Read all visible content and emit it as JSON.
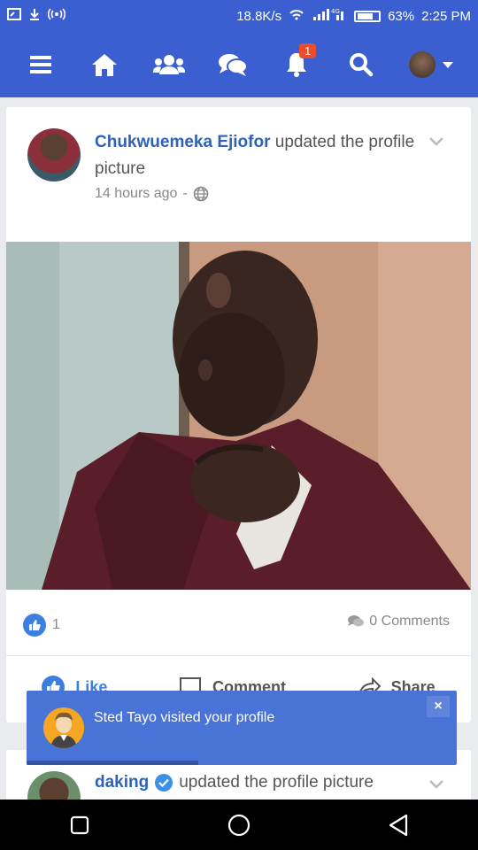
{
  "status_bar": {
    "speed": "18.8K/s",
    "network": "4G",
    "battery": "63%",
    "time": "2:25 PM"
  },
  "nav": {
    "notifications_badge": "1"
  },
  "post": {
    "author": "Chukwuemeka Ejiofor",
    "action": "updated the profile picture",
    "time": "14 hours ago",
    "separator": "-",
    "like_count": "1",
    "comments": "0 Comments",
    "actions": {
      "like": "Like",
      "comment": "Comment",
      "share": "Share"
    }
  },
  "toast": {
    "message": "Sted Tayo visited your profile",
    "close": "×",
    "progress": 0.4
  },
  "post2": {
    "author": "daking",
    "action": "updated the profile picture"
  },
  "colors": {
    "brand": "#3b5fd0",
    "link": "#2d62b8",
    "like": "#3d7fe0",
    "badge": "#ea4d2c",
    "toast": "#4a73d8"
  }
}
